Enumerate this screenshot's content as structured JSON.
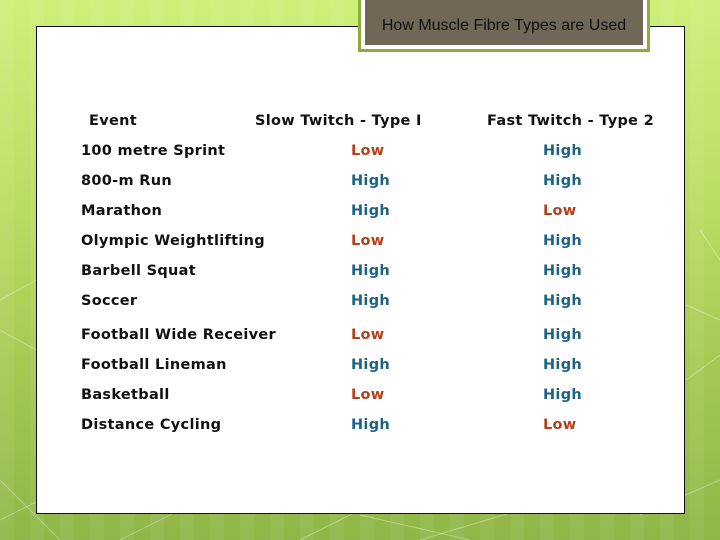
{
  "title": "How Muscle Fibre Types are Used",
  "table": {
    "headers": {
      "event": "Event",
      "slow": "Slow Twitch - Type I",
      "fast": "Fast Twitch - Type 2"
    },
    "rows": [
      {
        "event": "100 metre Sprint",
        "slow": "Low",
        "fast": "High"
      },
      {
        "event": "800-m Run",
        "slow": "High",
        "fast": "High"
      },
      {
        "event": "Marathon",
        "slow": "High",
        "fast": "Low"
      },
      {
        "event": "Olympic Weightlifting",
        "slow": "Low",
        "fast": "High"
      },
      {
        "event": "Barbell Squat",
        "slow": "High",
        "fast": "High"
      },
      {
        "event": "Soccer",
        "slow": "High",
        "fast": "High"
      },
      {
        "event": "Football Wide Receiver",
        "slow": "Low",
        "fast": "High"
      },
      {
        "event": "Football Lineman",
        "slow": "High",
        "fast": "High"
      },
      {
        "event": "Basketball",
        "slow": "Low",
        "fast": "High"
      },
      {
        "event": "Distance Cycling",
        "slow": "High",
        "fast": "Low"
      }
    ]
  },
  "colors": {
    "low": "#b5401a",
    "high": "#1d6287",
    "title_bg": "#706757",
    "accent_green": "#8cad3c"
  }
}
